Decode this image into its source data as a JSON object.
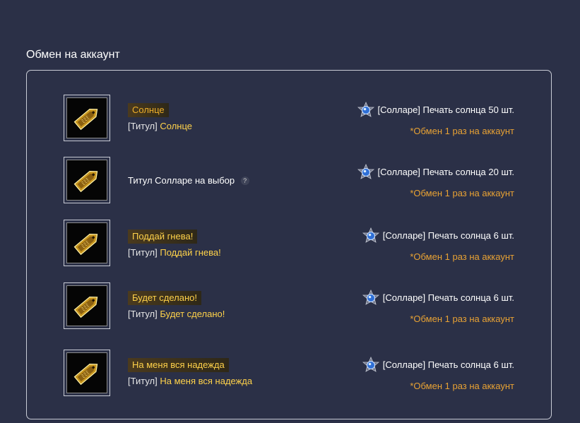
{
  "section_title": "Обмен на аккаунт",
  "colors": {
    "background": "#2b3047",
    "gold_text": "#ffd24a",
    "orange_note": "#e8a234"
  },
  "items": [
    {
      "icon": "title-ticket-icon",
      "badge": "Солнце",
      "sub_prefix": "[Титул]",
      "sub_value": "Солнце",
      "price": "[Солларе] Печать солнца 50 шт.",
      "limit": "*Обмен 1 раз на аккаунт"
    },
    {
      "icon": "title-ticket-icon",
      "choice_label": "Титул Солларе на выбор",
      "help_mark": "?",
      "price": "[Солларе] Печать солнца 20 шт.",
      "limit": "*Обмен 1 раз на аккаунт"
    },
    {
      "icon": "title-ticket-icon",
      "badge": "Поддай гнева!",
      "sub_prefix": "[Титул]",
      "sub_value": "Поддай гнева!",
      "price": "[Солларе] Печать солнца 6 шт.",
      "limit": "*Обмен 1 раз на аккаунт"
    },
    {
      "icon": "title-ticket-icon",
      "badge": "Будет сделано!",
      "sub_prefix": "[Титул]",
      "sub_value": "Будет сделано!",
      "price": "[Солларе] Печать солнца 6 шт.",
      "limit": "*Обмен 1 раз на аккаунт"
    },
    {
      "icon": "title-ticket-icon",
      "badge": "На меня вся надежда",
      "sub_prefix": "[Титул]",
      "sub_value": "На меня вся надежда",
      "price": "[Солларе] Печать солнца 6 шт.",
      "limit": "*Обмен 1 раз на аккаунт"
    }
  ]
}
